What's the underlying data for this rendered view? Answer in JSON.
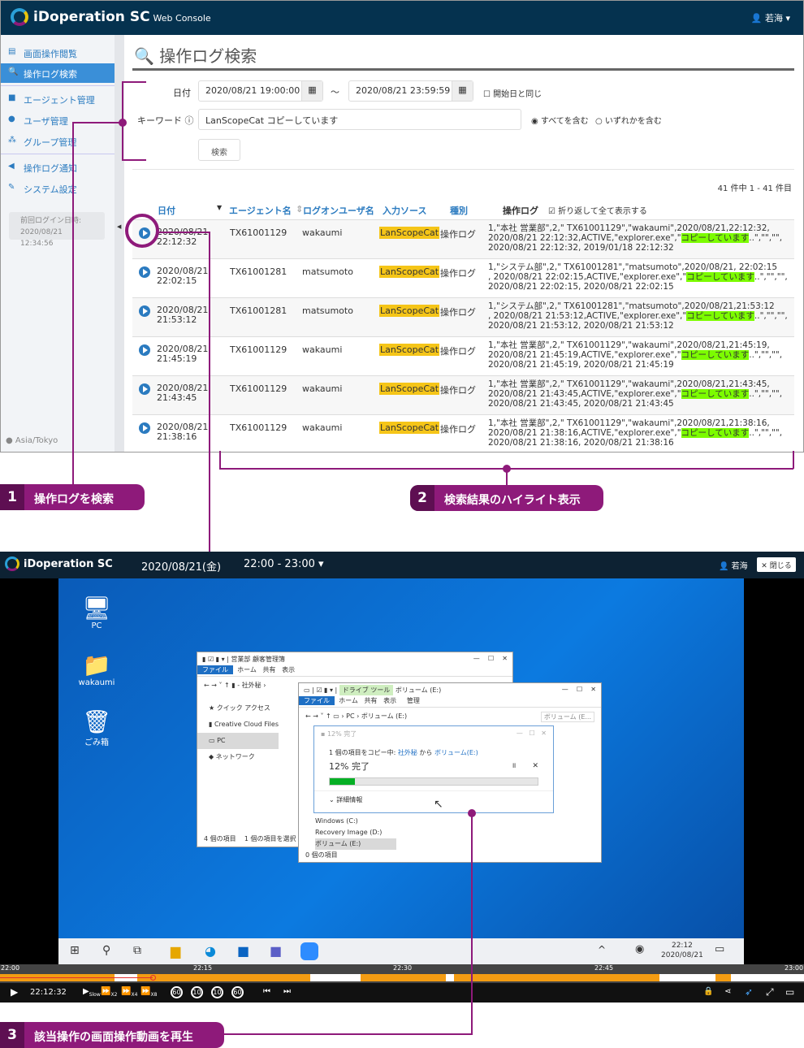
{
  "app": {
    "brand": "iDoperation SC",
    "brand_sub": "Web Console",
    "user": "若海",
    "user_icon": "user-icon"
  },
  "sidebar": {
    "items": [
      {
        "label": "画面操作閲覧",
        "icon": "film-icon"
      },
      {
        "label": "操作ログ検索",
        "icon": "search-icon",
        "active": true
      },
      {
        "label": "エージェント管理",
        "icon": "video-icon"
      },
      {
        "label": "ユーザ管理",
        "icon": "user-icon"
      },
      {
        "label": "グループ管理",
        "icon": "users-icon"
      },
      {
        "label": "操作ログ通知",
        "icon": "megaphone-icon"
      },
      {
        "label": "システム設定",
        "icon": "wrench-icon"
      }
    ],
    "last_login_label": "前回ログイン日時:",
    "last_login_value": "2020/08/21 12:34:56",
    "timezone": "Asia/Tokyo"
  },
  "search": {
    "title": "操作ログ検索",
    "date_label": "日付",
    "date_from": "2020/08/21 19:00:00",
    "tilde": "～",
    "date_to": "2020/08/21 23:59:59",
    "same_as_start": "開始日と同じ",
    "keyword_label": "キーワード",
    "keyword_value": "LanScopeCat コピーしています",
    "match_all": "すべてを含む",
    "match_any": "いずれかを含む",
    "search_button": "検索"
  },
  "results": {
    "count": "41 件中 1 - 41 件目",
    "columns": [
      "日付",
      "エージェント名",
      "ログオンユーザ名",
      "入力ソース",
      "種別",
      "操作ログ"
    ],
    "wrap_label": "折り返して全て表示する",
    "wrap_checked": true,
    "rows": [
      {
        "date": "2020/08/21",
        "time": "22:12:32",
        "agent": "TX61001129",
        "user": "wakaumi",
        "source": "LanScopeCat",
        "type": "操作ログ",
        "l1": "1,\"本社 営業部\",2,\" TX61001129\",\"wakaumi\",2020/08/21,22:12:32,",
        "l2a": "2020/08/21 22:12:32,ACTIVE,\"explorer.exe\",\"",
        "hl": "コピーしています",
        "l2b": "..\",\"\",\"\",",
        "l3": "2020/08/21 22:12:32, 2019/01/18 22:12:32"
      },
      {
        "date": "2020/08/21",
        "time": "22:02:15",
        "agent": "TX61001281",
        "user": "matsumoto",
        "source": "LanScopeCat",
        "type": "操作ログ",
        "l1": "1,\"システム部\",2,\" TX61001281\",\"matsumoto\",2020/08/21, 22:02:15",
        "l2a": ", 2020/08/21 22:02:15,ACTIVE,\"explorer.exe\",\"",
        "hl": "コピーしています",
        "l2b": "..\",\"\",\"\",",
        "l3": "2020/08/21 22:02:15, 2020/08/21 22:02:15"
      },
      {
        "date": "2020/08/21",
        "time": "21:53:12",
        "agent": "TX61001281",
        "user": "matsumoto",
        "source": "LanScopeCat",
        "type": "操作ログ",
        "l1": "1,\"システム部\",2,\" TX61001281\",\"matsumoto\",2020/08/21,21:53:12",
        "l2a": ", 2020/08/21 21:53:12,ACTIVE,\"explorer.exe\",\"",
        "hl": "コピーしています",
        "l2b": "..\",\"\",\"\",",
        "l3": "2020/08/21 21:53:12, 2020/08/21 21:53:12"
      },
      {
        "date": "2020/08/21",
        "time": "21:45:19",
        "agent": "TX61001129",
        "user": "wakaumi",
        "source": "LanScopeCat",
        "type": "操作ログ",
        "l1": "1,\"本社 営業部\",2,\" TX61001129\",\"wakaumi\",2020/08/21,21:45:19,",
        "l2a": "2020/08/21 21:45:19,ACTIVE,\"explorer.exe\",\"",
        "hl": "コピーしています",
        "l2b": "..\",\"\",\"\",",
        "l3": "2020/08/21 21:45:19, 2020/08/21 21:45:19"
      },
      {
        "date": "2020/08/21",
        "time": "21:43:45",
        "agent": "TX61001129",
        "user": "wakaumi",
        "source": "LanScopeCat",
        "type": "操作ログ",
        "l1": "1,\"本社 営業部\",2,\" TX61001129\",\"wakaumi\",2020/08/21,21:43:45,",
        "l2a": "2020/08/21 21:43:45,ACTIVE,\"explorer.exe\",\"",
        "hl": "コピーしています",
        "l2b": "..\",\"\",\"\",",
        "l3": "2020/08/21 21:43:45, 2020/08/21 21:43:45"
      },
      {
        "date": "2020/08/21",
        "time": "21:38:16",
        "agent": "TX61001129",
        "user": "wakaumi",
        "source": "LanScopeCat",
        "type": "操作ログ",
        "l1": "1,\"本社 営業部\",2,\" TX61001129\",\"wakaumi\",2020/08/21,21:38:16,",
        "l2a": "2020/08/21 21:38:16,ACTIVE,\"explorer.exe\",\"",
        "hl": "コピーしています",
        "l2b": "..\",\"\",\"\",",
        "l3": "2020/08/21 21:38:16, 2020/08/21 21:38:16"
      }
    ]
  },
  "callouts": [
    {
      "num": "1",
      "text": "操作ログを検索"
    },
    {
      "num": "2",
      "text": "検索結果のハイライト表示"
    },
    {
      "num": "3",
      "text": "該当操作の画面操作動画を再生"
    }
  ],
  "colors": {
    "accent": "#8e1a7a",
    "header": "#05324f",
    "link": "#2b7bc0",
    "highlight": "#7cfc00",
    "source_badge": "#f5c518",
    "timeline_activity": "#f39c12"
  },
  "player": {
    "brand": "iDoperation SC",
    "date": "2020/08/21(金)",
    "range": "22:00 - 23:00",
    "user": "若海",
    "close": "閉じる",
    "desktop_icons": [
      "PC",
      "wakaumi",
      "ごみ箱"
    ],
    "explorer1": {
      "title": "営業部 顧客管理簿",
      "tabs": [
        "ファイル",
        "ホーム",
        "共有",
        "表示"
      ],
      "path": "社外秘",
      "nav": [
        "クイック アクセス",
        "Creative Cloud Files",
        "PC",
        "ネットワーク"
      ],
      "status": "4 個の項目",
      "status2": "1 個の項目を選択 28"
    },
    "explorer2": {
      "title": "ボリューム (E:)",
      "tool_tab": "ドライブ ツール",
      "manage": "管理",
      "tabs": [
        "ファイル",
        "ホーム",
        "共有",
        "表示"
      ],
      "path": "PC › ボリューム (E:)",
      "search": "ボリューム (E...",
      "drives": [
        "Windows (C:)",
        "Recovery Image (D:)",
        "ボリューム (E:)"
      ],
      "status": "0 個の項目"
    },
    "copy_dialog": {
      "title": "12% 完了",
      "line_pre": "1 個の項目をコピー中: ",
      "from": "社外秘",
      "mid": " から ",
      "to": "ボリューム(E:)",
      "big": "12% 完了",
      "progress": 0.12,
      "details": "詳細情報"
    },
    "tray": {
      "time": "22:12",
      "date": "2020/08/21"
    },
    "timeline": {
      "ticks": [
        "22:00",
        "22:15",
        "22:30",
        "22:45",
        "23:00"
      ],
      "position": "22:12:32",
      "speeds": [
        "Slow",
        "X2",
        "X4",
        "X8"
      ],
      "skips": [
        "60",
        "10",
        "10",
        "60"
      ]
    }
  }
}
